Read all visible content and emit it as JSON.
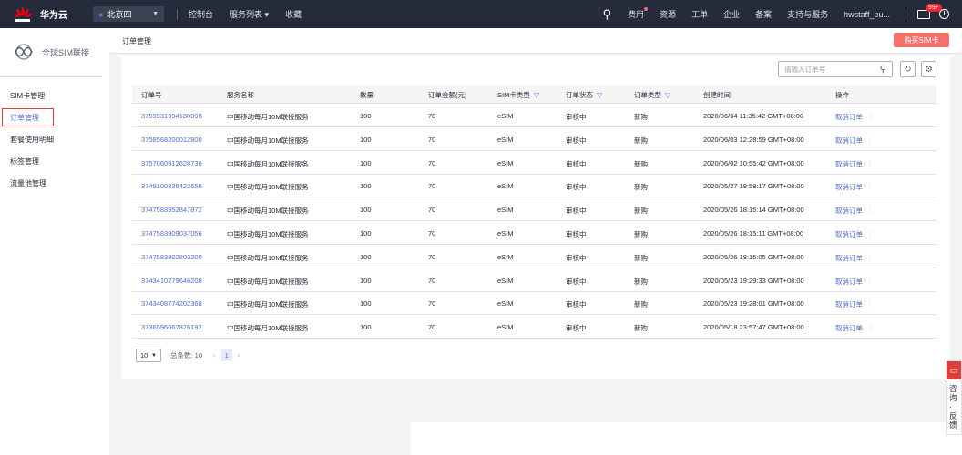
{
  "nav": {
    "brand": "华为云",
    "region": "北京四",
    "links": [
      "控制台",
      "服务列表",
      "收藏"
    ],
    "right": [
      "费用",
      "资源",
      "工单",
      "企业",
      "备案",
      "支持与服务",
      "hwstaff_pu..."
    ],
    "badge": "99+"
  },
  "sidebar": {
    "title": "全球SIM联接",
    "items": [
      "SIM卡管理",
      "订单管理",
      "套餐使用明细",
      "标签管理",
      "流量池管理"
    ]
  },
  "header": {
    "title": "订单管理",
    "buy_label": "购买SIM卡"
  },
  "search": {
    "placeholder": "请输入订单号"
  },
  "table": {
    "columns": [
      "订单号",
      "服务名称",
      "数量",
      "订单金额(元)",
      "SIM卡类型",
      "订单状态",
      "订单类型",
      "创建时间",
      "操作"
    ],
    "rows": [
      {
        "id": "3759931394180096",
        "service": "中国移动每月10M联接服务",
        "qty": "100",
        "amount": "70",
        "sim": "eSIM",
        "status": "审核中",
        "type": "新购",
        "time": "2020/06/04 11:35:42 GMT+08:00",
        "op": "取消订单"
      },
      {
        "id": "3758568200012800",
        "service": "中国移动每月10M联接服务",
        "qty": "100",
        "amount": "70",
        "sim": "eSIM",
        "status": "审核中",
        "type": "新购",
        "time": "2020/06/03 12:28:59 GMT+08:00",
        "op": "取消订单"
      },
      {
        "id": "3757060912628736",
        "service": "中国移动每月10M联接服务",
        "qty": "100",
        "amount": "70",
        "sim": "eSIM",
        "status": "审核中",
        "type": "新购",
        "time": "2020/06/02 10:55:42 GMT+08:00",
        "op": "取消订单"
      },
      {
        "id": "3749100836422656",
        "service": "中国移动每月10M联接服务",
        "qty": "100",
        "amount": "70",
        "sim": "eSIM",
        "status": "审核中",
        "type": "新购",
        "time": "2020/05/27 19:58:17 GMT+08:00",
        "op": "取消订单"
      },
      {
        "id": "3747583952847872",
        "service": "中国移动每月10M联接服务",
        "qty": "100",
        "amount": "70",
        "sim": "eSIM",
        "status": "审核中",
        "type": "新购",
        "time": "2020/05/26 18:15:14 GMT+08:00",
        "op": "取消订单"
      },
      {
        "id": "3747583909037056",
        "service": "中国移动每月10M联接服务",
        "qty": "100",
        "amount": "70",
        "sim": "eSIM",
        "status": "审核中",
        "type": "新购",
        "time": "2020/05/26 18:15:11 GMT+08:00",
        "op": "取消订单"
      },
      {
        "id": "3747583802803200",
        "service": "中国移动每月10M联接服务",
        "qty": "100",
        "amount": "70",
        "sim": "eSIM",
        "status": "审核中",
        "type": "新购",
        "time": "2020/05/26 18:15:05 GMT+08:00",
        "op": "取消订单"
      },
      {
        "id": "3743410279646208",
        "service": "中国移动每月10M联接服务",
        "qty": "100",
        "amount": "70",
        "sim": "eSIM",
        "status": "审核中",
        "type": "新购",
        "time": "2020/05/23 19:29:33 GMT+08:00",
        "op": "取消订单"
      },
      {
        "id": "3743408774202368",
        "service": "中国移动每月10M联接服务",
        "qty": "100",
        "amount": "70",
        "sim": "eSIM",
        "status": "审核中",
        "type": "新购",
        "time": "2020/05/23 19:28:01 GMT+08:00",
        "op": "取消订单"
      },
      {
        "id": "3736596067876192",
        "service": "中国移动每月10M联接服务",
        "qty": "100",
        "amount": "70",
        "sim": "eSIM",
        "status": "审核中",
        "type": "新购",
        "time": "2020/05/18 23:57:47 GMT+08:00",
        "op": "取消订单"
      }
    ]
  },
  "pager": {
    "size": "10",
    "total": "总条数: 10",
    "current": "1"
  },
  "float": {
    "text": "咨询·反馈"
  },
  "colors": {
    "topbar": "#252b3a",
    "link": "#526ecc",
    "buy": "#f66f6a",
    "highlight": "#e03d3d"
  }
}
